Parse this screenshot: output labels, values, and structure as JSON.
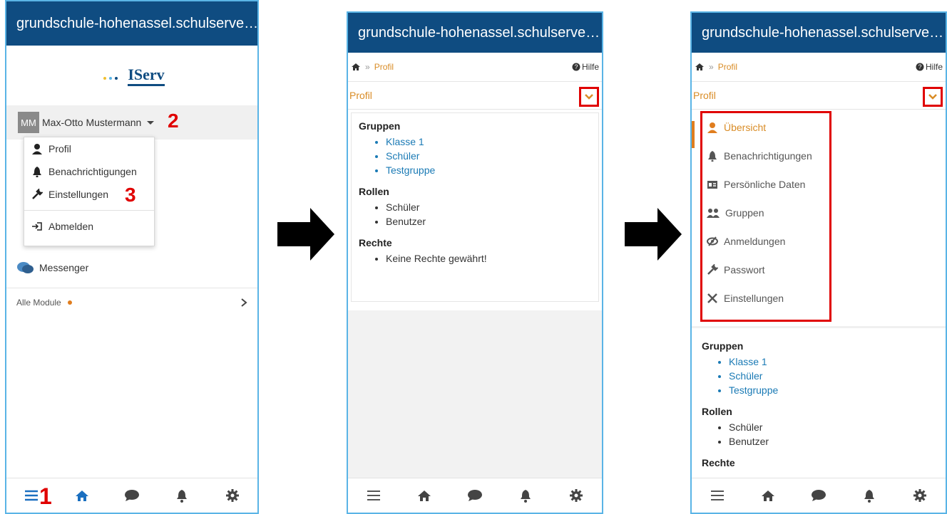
{
  "title": "grundschule-hohenassel.schulserve…",
  "logo_text": "IServ",
  "user": {
    "initials": "MM",
    "name": "Max-Otto Mustermann"
  },
  "dropdown": [
    "Profil",
    "Benachrichtigungen",
    "Einstellungen",
    "Abmelden"
  ],
  "sidebar": {
    "messenger": "Messenger",
    "all_modules": "Alle Module"
  },
  "step_numbers": {
    "one": "1",
    "two": "2",
    "three": "3"
  },
  "breadcrumb": {
    "page": "Profil",
    "help": "Hilfe",
    "sep": "»"
  },
  "profile_label": "Profil",
  "sections": {
    "groups": {
      "title": "Gruppen",
      "items": [
        "Klasse 1",
        "Schüler",
        "Testgruppe"
      ]
    },
    "roles": {
      "title": "Rollen",
      "items": [
        "Schüler",
        "Benutzer"
      ]
    },
    "rights": {
      "title": "Rechte",
      "items": [
        "Keine Rechte gewährt!"
      ]
    }
  },
  "menu": [
    "Übersicht",
    "Benachrichtigungen",
    "Persönliche Daten",
    "Gruppen",
    "Anmeldungen",
    "Passwort",
    "Einstellungen"
  ],
  "colors": {
    "header": "#0f4c81",
    "accent": "#d98c26",
    "link": "#1a7ab5",
    "highlight": "#e00000",
    "border": "#5ab4e6"
  }
}
